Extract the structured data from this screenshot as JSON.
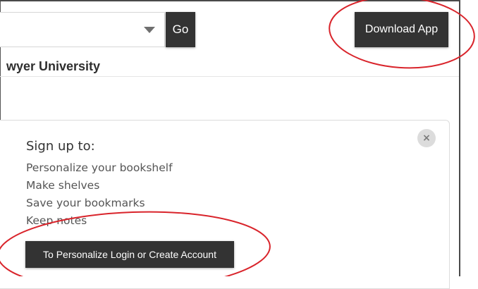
{
  "toolbar": {
    "select_value": "",
    "go_label": "Go",
    "download_label": "Download App"
  },
  "institution": {
    "name": "wyer University"
  },
  "signup_card": {
    "title": "Sign up to:",
    "benefits": [
      "Personalize your bookshelf",
      "Make shelves",
      "Save your bookmarks",
      "Keep notes"
    ],
    "login_label": "To Personalize Login or Create Account",
    "close_glyph": "×"
  },
  "colors": {
    "button_bg": "#333333",
    "annotation": "#d9242b"
  },
  "icons": {
    "select_caret": "chevron-down-icon",
    "close": "close-icon"
  }
}
